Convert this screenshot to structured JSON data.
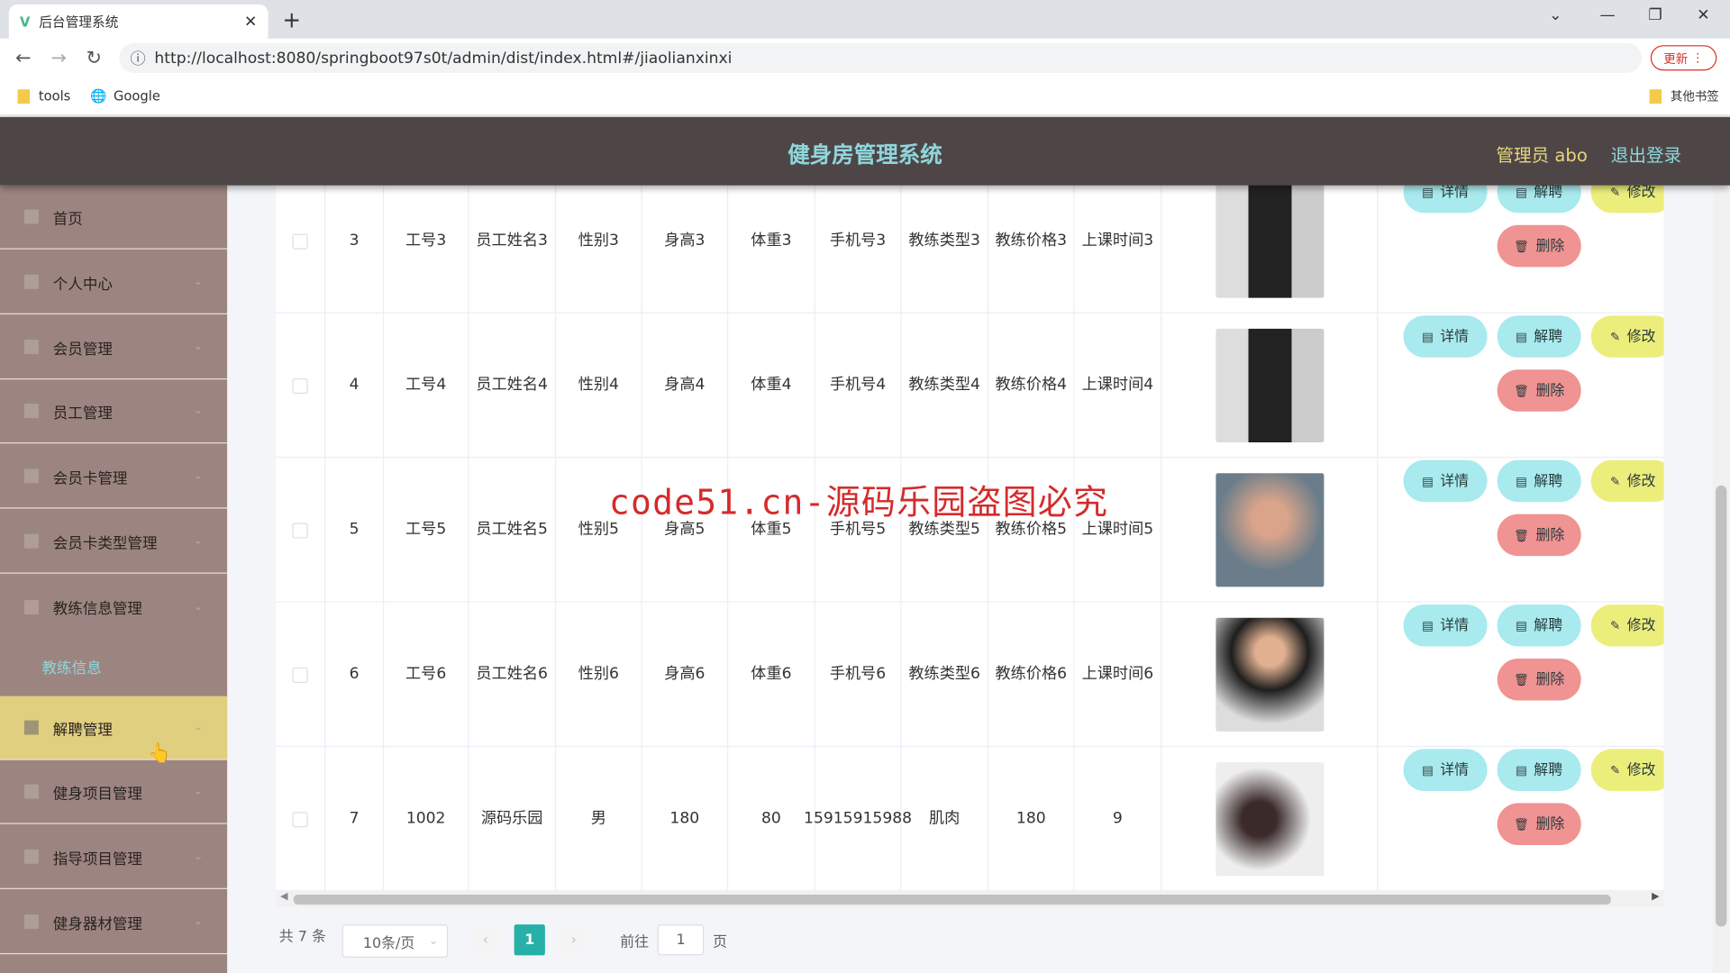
{
  "browser": {
    "tab_title": "后台管理系统",
    "url": "http://localhost:8080/springboot97s0t/admin/dist/index.html#/jiaolianxinxi",
    "update_label": "更新",
    "bookmarks": [
      "tools",
      "Google"
    ],
    "other_bookmarks": "其他书签"
  },
  "header": {
    "title": "健身房管理系统",
    "admin": "管理员 abo",
    "logout": "退出登录"
  },
  "sidebar": {
    "items": [
      {
        "label": "首页"
      },
      {
        "label": "个人中心"
      },
      {
        "label": "会员管理"
      },
      {
        "label": "员工管理"
      },
      {
        "label": "会员卡管理"
      },
      {
        "label": "会员卡类型管理"
      },
      {
        "label": "教练信息管理"
      },
      {
        "label": "解聘管理",
        "active": true
      },
      {
        "label": "健身项目管理"
      },
      {
        "label": "指导项目管理"
      },
      {
        "label": "健身器材管理"
      }
    ],
    "submenu": "教练信息"
  },
  "table": {
    "rows": [
      {
        "index": "3",
        "gonghao": "工号3",
        "name": "员工姓名3",
        "gender": "性别3",
        "height": "身高3",
        "weight": "体重3",
        "phone": "手机号3",
        "type": "教练类型3",
        "price": "教练价格3",
        "time": "上课时间3"
      },
      {
        "index": "4",
        "gonghao": "工号4",
        "name": "员工姓名4",
        "gender": "性别4",
        "height": "身高4",
        "weight": "体重4",
        "phone": "手机号4",
        "type": "教练类型4",
        "price": "教练价格4",
        "time": "上课时间4"
      },
      {
        "index": "5",
        "gonghao": "工号5",
        "name": "员工姓名5",
        "gender": "性别5",
        "height": "身高5",
        "weight": "体重5",
        "phone": "手机号5",
        "type": "教练类型5",
        "price": "教练价格5",
        "time": "上课时间5"
      },
      {
        "index": "6",
        "gonghao": "工号6",
        "name": "员工姓名6",
        "gender": "性别6",
        "height": "身高6",
        "weight": "体重6",
        "phone": "手机号6",
        "type": "教练类型6",
        "price": "教练价格6",
        "time": "上课时间6"
      },
      {
        "index": "7",
        "gonghao": "1002",
        "name": "源码乐园",
        "gender": "男",
        "height": "180",
        "weight": "80",
        "phone": "15915915988",
        "type": "肌肉",
        "price": "180",
        "time": "9"
      }
    ],
    "actions": {
      "detail": "详情",
      "fire": "解聘",
      "edit": "修改",
      "delete": "删除"
    }
  },
  "pagination": {
    "total": "共 7 条",
    "page_size": "10条/页",
    "current": "1",
    "goto_label": "前往",
    "goto_value": "1",
    "page_suffix": "页"
  },
  "watermark": "code51.cn-源码乐园盗图必究",
  "colors": {
    "header_bg": "#4e4646",
    "sidebar_bg": "#9c8580",
    "active_menu": "#e0cf7f",
    "accent": "#8fd6dc",
    "page_active": "#26b0a8"
  }
}
